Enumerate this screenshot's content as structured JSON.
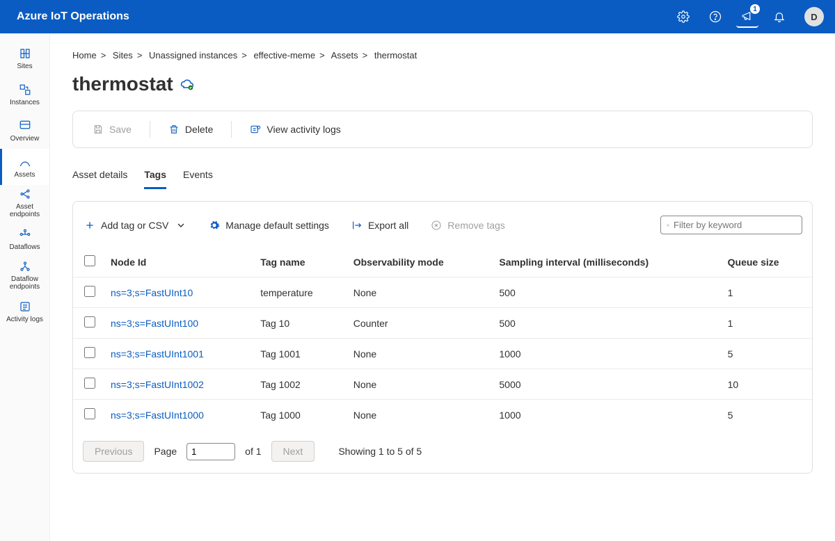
{
  "header": {
    "brand": "Azure IoT Operations",
    "avatar": "D",
    "alert_badge": "1"
  },
  "sidebar": {
    "items": [
      {
        "label": "Sites"
      },
      {
        "label": "Instances"
      },
      {
        "label": "Overview"
      },
      {
        "label": "Assets"
      },
      {
        "label": "Asset endpoints"
      },
      {
        "label": "Dataflows"
      },
      {
        "label": "Dataflow endpoints"
      },
      {
        "label": "Activity logs"
      }
    ]
  },
  "breadcrumb": {
    "parts": [
      "Home",
      "Sites",
      "Unassigned instances",
      "effective-meme",
      "Assets",
      "thermostat"
    ]
  },
  "page": {
    "title": "thermostat"
  },
  "toolbar": {
    "save": "Save",
    "delete": "Delete",
    "activity": "View activity logs"
  },
  "tabs": {
    "items": [
      "Asset details",
      "Tags",
      "Events"
    ]
  },
  "actions": {
    "add": "Add tag or CSV",
    "manage": "Manage default settings",
    "export": "Export all",
    "remove": "Remove tags",
    "filter_placeholder": "Filter by keyword"
  },
  "table": {
    "headers": {
      "node": "Node Id",
      "tag": "Tag name",
      "obs": "Observability mode",
      "samp": "Sampling interval (milliseconds)",
      "queue": "Queue size"
    },
    "rows": [
      {
        "node": "ns=3;s=FastUInt10",
        "tag": "temperature",
        "obs": "None",
        "samp": "500",
        "queue": "1"
      },
      {
        "node": "ns=3;s=FastUInt100",
        "tag": "Tag 10",
        "obs": "Counter",
        "samp": "500",
        "queue": "1"
      },
      {
        "node": "ns=3;s=FastUInt1001",
        "tag": "Tag 1001",
        "obs": "None",
        "samp": "1000",
        "queue": "5"
      },
      {
        "node": "ns=3;s=FastUInt1002",
        "tag": "Tag 1002",
        "obs": "None",
        "samp": "5000",
        "queue": "10"
      },
      {
        "node": "ns=3;s=FastUInt1000",
        "tag": "Tag 1000",
        "obs": "None",
        "samp": "1000",
        "queue": "5"
      }
    ]
  },
  "pager": {
    "previous": "Previous",
    "next": "Next",
    "page_label": "Page",
    "page_value": "1",
    "of_label": "of 1",
    "summary": "Showing 1 to 5 of 5"
  }
}
